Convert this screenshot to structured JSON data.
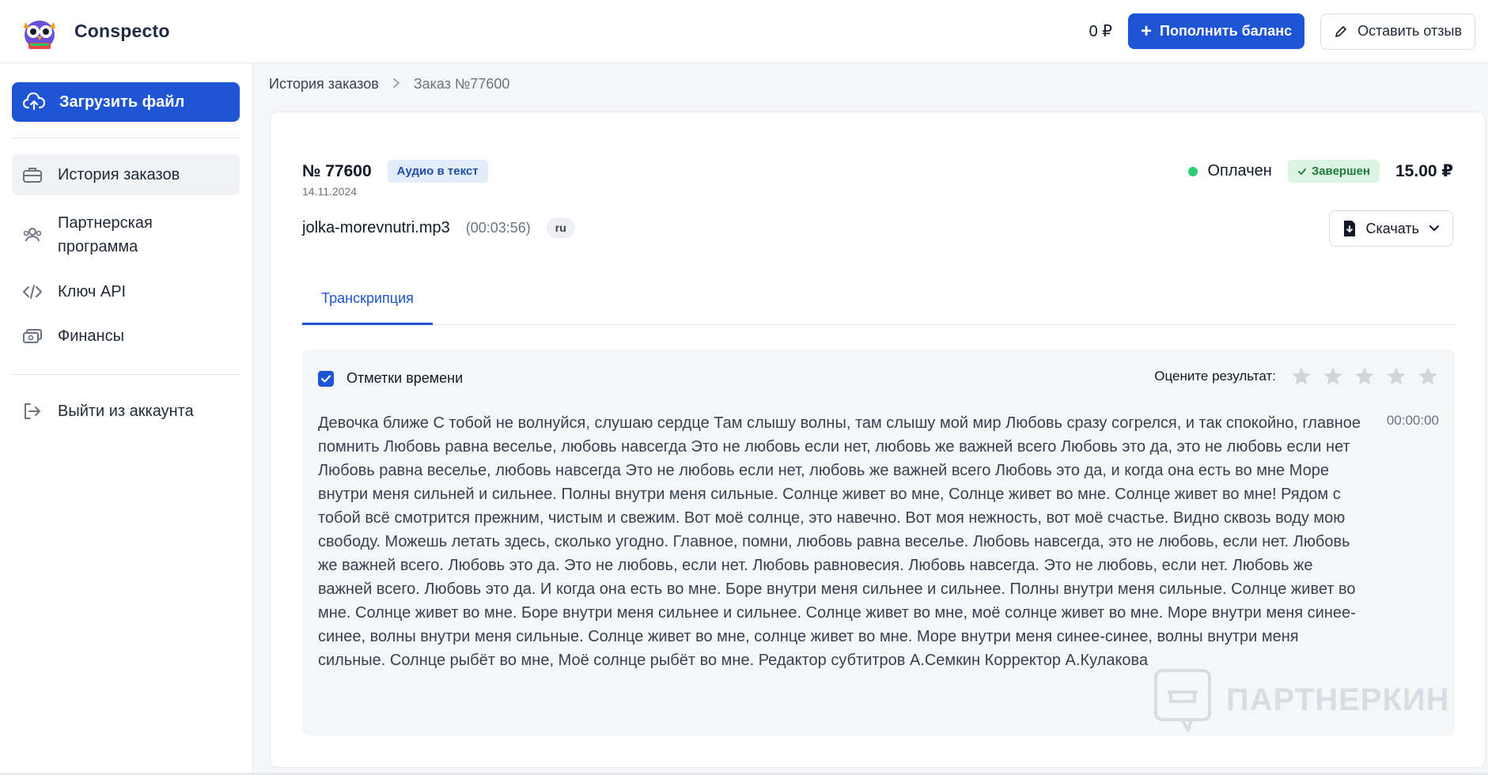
{
  "brand": {
    "name": "Conspecto",
    "logo_icon": "owl-logo-icon"
  },
  "header": {
    "balance": "0 ₽",
    "topup_label": "Пополнить баланс",
    "review_label": "Оставить отзыв"
  },
  "sidebar": {
    "upload_label": "Загрузить файл",
    "items": [
      {
        "label": "История заказов",
        "icon": "briefcase-icon",
        "active": true
      },
      {
        "label": "Партнерская программа",
        "line1": "Партнерская",
        "line2": "программа",
        "icon": "users-icon"
      },
      {
        "label": "Ключ API",
        "icon": "code-icon"
      },
      {
        "label": "Финансы",
        "icon": "wallet-icon"
      }
    ],
    "logout_label": "Выйти из аккаунта"
  },
  "breadcrumb": {
    "parent": "История заказов",
    "current": "Заказ №77600"
  },
  "order": {
    "number": "№ 77600",
    "type_badge": "Аудио в текст",
    "date": "14.11.2024",
    "payment_status": "Оплачен",
    "status_badge": "Завершен",
    "price": "15.00 ₽",
    "file_name": "jolka-morevnutri.mp3",
    "duration": "(00:03:56)",
    "language": "ru",
    "download_label": "Скачать"
  },
  "tabs": [
    {
      "label": "Транскрипция",
      "active": true
    }
  ],
  "transcript": {
    "timestamps_label": "Отметки времени",
    "timestamps_checked": true,
    "rate_label": "Оцените результат:",
    "rating": 0,
    "max_rating": 5,
    "time": "00:00:00",
    "text": "Девочка ближе С тобой не волнуйся, слушаю сердце Там слышу волны, там слышу мой мир Любовь сразу согрелся, и так спокойно, главное помнить Любовь равна веселье, любовь навсегда Это не любовь если нет, любовь же важней всего Любовь это да, это не любовь если нет Любовь равна веселье, любовь навсегда Это не любовь если нет, любовь же важней всего Любовь это да, и когда она есть во мне Море внутри меня сильней и сильнее. Полны внутри меня сильные. Солнце живет во мне, Солнце живет во мне. Солнце живет во мне! Рядом с тобой всё смотрится прежним, чистым и свежим. Вот моё солнце, это навечно. Вот моя нежность, вот моё счастье. Видно сквозь воду мою свободу. Можешь летать здесь, сколько угодно. Главное, помни, любовь равна веселье. Любовь навсегда, это не любовь, если нет. Любовь же важней всего. Любовь это да. Это не любовь, если нет. Любовь равновесия. Любовь навсегда. Это не любовь, если нет. Любовь же важней всего. Любовь это да. И когда она есть во мне. Боре внутри меня сильнее и сильнее. Полны внутри меня сильные. Солнце живет во мне. Солнце живет во мне. Боре внутри меня сильнее и сильнее. Солнце живет во мне, моё солнце живет во мне. Море внутри меня синее-синее, волны внутри меня сильные. Солнце живет во мне, солнце живет во мне. Море внутри меня синее-синее, волны внутри меня сильные. Солнце рыбёт во мне, Моё солнце рыбёт во мне. Редактор субтитров А.Семкин Корректор А.Кулакова"
  },
  "watermark": {
    "text": "ПАРТНЕРКИН"
  },
  "colors": {
    "primary": "#1e54d6",
    "paid_dot": "#2ecc71",
    "completed_bg": "#dcf5e3",
    "type_badge_bg": "#e3ecfb"
  }
}
